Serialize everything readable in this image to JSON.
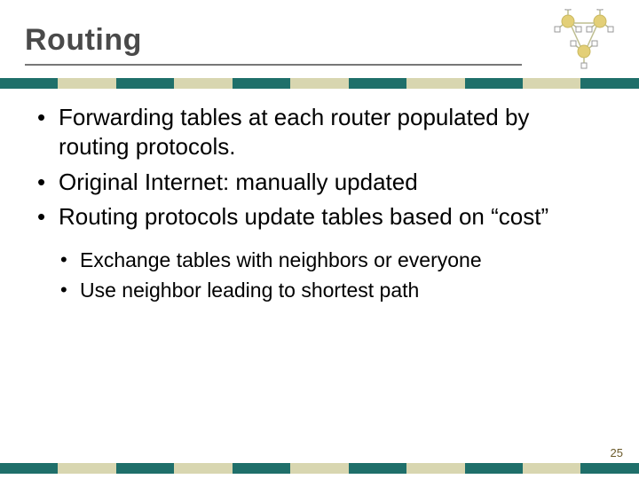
{
  "title": "Routing",
  "bullets": [
    "Forwarding tables at each router populated by routing protocols.",
    "Original Internet: manually updated",
    "Routing protocols update tables based on “cost”"
  ],
  "sub_bullets": [
    "Exchange tables with neighbors or everyone",
    "Use neighbor leading to shortest path"
  ],
  "page_number": "25",
  "stripe_colors": [
    "#1f6f6a",
    "#d8d6b0",
    "#1f6f6a",
    "#d8d6b0",
    "#1f6f6a",
    "#d8d6b0",
    "#1f6f6a",
    "#d8d6b0",
    "#1f6f6a",
    "#d8d6b0",
    "#1f6f6a"
  ],
  "logo": {
    "description": "network-ring-icon"
  }
}
